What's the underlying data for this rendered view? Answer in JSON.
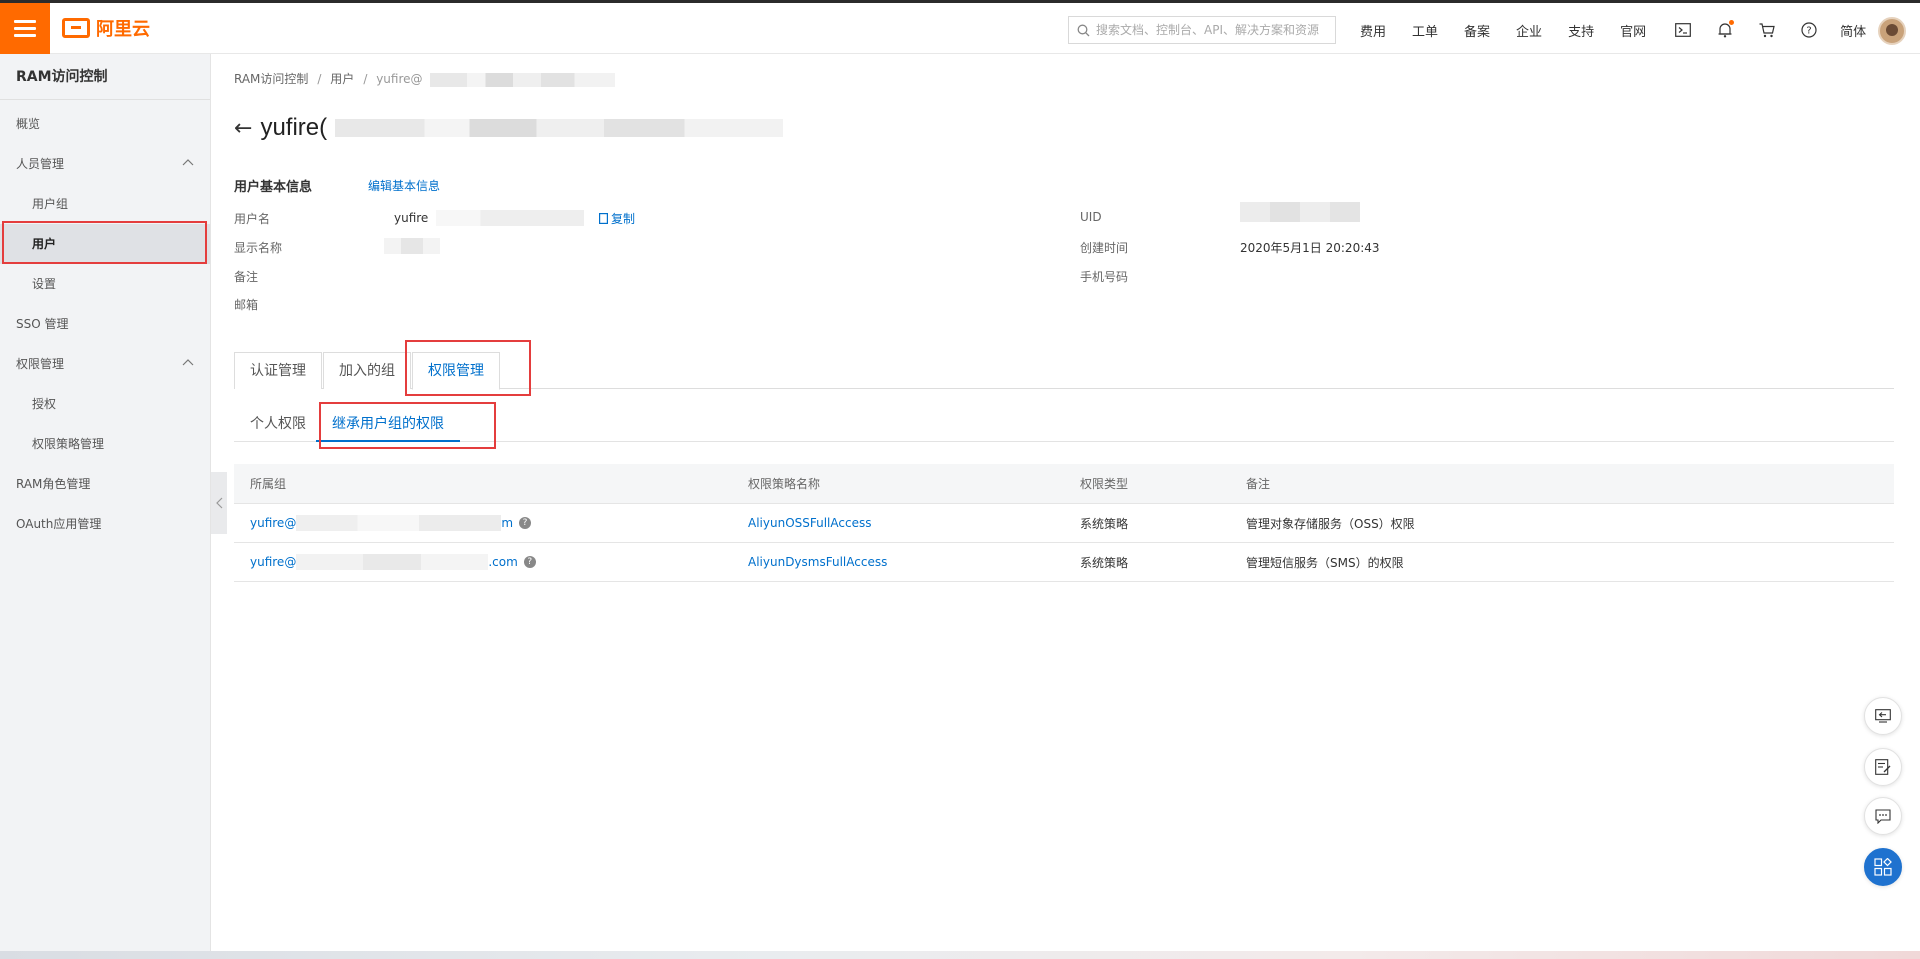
{
  "topbar": {
    "logo_text": "阿里云",
    "search_placeholder": "搜索文档、控制台、API、解决方案和资源",
    "links": [
      "费用",
      "工单",
      "备案",
      "企业",
      "支持",
      "官网"
    ],
    "language": "简体",
    "icons": [
      "terminal-icon",
      "bell-icon",
      "cart-icon",
      "help-icon"
    ]
  },
  "sidebar": {
    "title": "RAM访问控制",
    "items": [
      {
        "label": "概览"
      },
      {
        "label": "人员管理"
      },
      {
        "label": "用户组"
      },
      {
        "label": "用户"
      },
      {
        "label": "设置"
      },
      {
        "label": "SSO 管理"
      },
      {
        "label": "权限管理"
      },
      {
        "label": "授权"
      },
      {
        "label": "权限策略管理"
      },
      {
        "label": "RAM角色管理"
      },
      {
        "label": "OAuth应用管理"
      }
    ]
  },
  "breadcrumb": {
    "items": [
      "RAM访问控制",
      "用户",
      "yufire@"
    ]
  },
  "page": {
    "title": "yufire("
  },
  "basic_info": {
    "heading": "用户基本信息",
    "edit_label": "编辑基本信息",
    "username_label": "用户名",
    "username_value": "yufire",
    "copy_label": "复制",
    "display_name_label": "显示名称",
    "remark_label": "备注",
    "email_label": "邮箱",
    "uid_label": "UID",
    "created_label": "创建时间",
    "created_value": "2020年5月1日 20:20:43",
    "phone_label": "手机号码"
  },
  "tabs": [
    "认证管理",
    "加入的组",
    "权限管理"
  ],
  "subtabs": [
    "个人权限",
    "继承用户组的权限"
  ],
  "table": {
    "columns": [
      "所属组",
      "权限策略名称",
      "权限类型",
      "备注"
    ],
    "rows": [
      {
        "group_prefix": "yufire@",
        "group_suffix": "m",
        "policy": "AliyunOSSFullAccess",
        "type": "系统策略",
        "note": "管理对象存储服务（OSS）权限"
      },
      {
        "group_prefix": "yufire@",
        "group_suffix": ".com",
        "policy": "AliyunDysmsFullAccess",
        "type": "系统策略",
        "note": "管理短信服务（SMS）的权限"
      }
    ]
  },
  "colors": {
    "brand": "#ff6a00",
    "link": "#0070cc",
    "highlight_box": "#e43d3d"
  }
}
